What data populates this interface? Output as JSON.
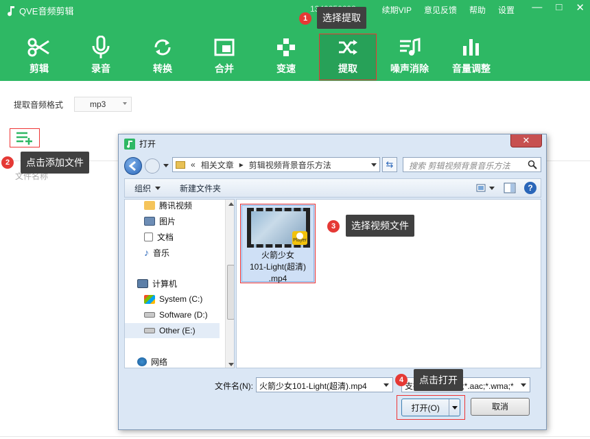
{
  "app": {
    "title": "QVE音频剪辑",
    "phone": "1340256698",
    "top_links": [
      "续期VIP",
      "意见反馈",
      "帮助",
      "设置"
    ],
    "window_controls": [
      "—",
      "□",
      "✕"
    ]
  },
  "toolbar": {
    "items": [
      {
        "label": "剪辑",
        "icon": "scissors-icon"
      },
      {
        "label": "录音",
        "icon": "microphone-icon"
      },
      {
        "label": "转换",
        "icon": "convert-icon"
      },
      {
        "label": "合并",
        "icon": "merge-icon"
      },
      {
        "label": "变速",
        "icon": "speed-icon"
      },
      {
        "label": "提取",
        "icon": "shuffle-icon",
        "active": true
      },
      {
        "label": "噪声消除",
        "icon": "noise-icon"
      },
      {
        "label": "音量调整",
        "icon": "volume-bars-icon"
      }
    ]
  },
  "main": {
    "format_label": "提取音频格式",
    "format_value": "mp3",
    "file_column": "文件名称"
  },
  "callouts": [
    {
      "num": "1",
      "text": "选择提取"
    },
    {
      "num": "2",
      "text": "点击添加文件"
    },
    {
      "num": "3",
      "text": "选择视频文件"
    },
    {
      "num": "4",
      "text": "点击打开"
    }
  ],
  "dialog": {
    "title": "打开",
    "close": "✕",
    "breadcrumb": [
      "«",
      "相关文章",
      "▸",
      "剪辑视频背景音乐方法"
    ],
    "search_placeholder": "搜索 剪辑视频背景音乐方法",
    "organize": "组织",
    "new_folder": "新建文件夹",
    "nav_items": [
      {
        "label": "腾讯视频",
        "icon": "folder-icon"
      },
      {
        "label": "图片",
        "icon": "pictures-icon"
      },
      {
        "label": "文档",
        "icon": "documents-icon"
      },
      {
        "label": "音乐",
        "icon": "music-icon"
      },
      {
        "label": "计算机",
        "icon": "computer-icon"
      },
      {
        "label": "System (C:)",
        "icon": "drive-icon"
      },
      {
        "label": "Software (D:)",
        "icon": "drive-icon"
      },
      {
        "label": "Other (E:)",
        "icon": "drive-icon",
        "selected": true
      },
      {
        "label": "网络",
        "icon": "network-icon"
      }
    ],
    "file": {
      "name_line1": "火箭少女",
      "name_line2": "101-Light(超清)",
      "name_line3": ".mp4",
      "badge": "Player"
    },
    "filename_label": "文件名(N):",
    "filename_value": "火箭少女101-Light(超清).mp4",
    "filetype_value": "支持格式(*.mp3;*.aac;*.wma;*",
    "open_button": "打开(O)",
    "cancel_button": "取消"
  },
  "colors": {
    "brand": "#2eb864",
    "highlight": "#e33333",
    "callout_bg": "#404040"
  }
}
